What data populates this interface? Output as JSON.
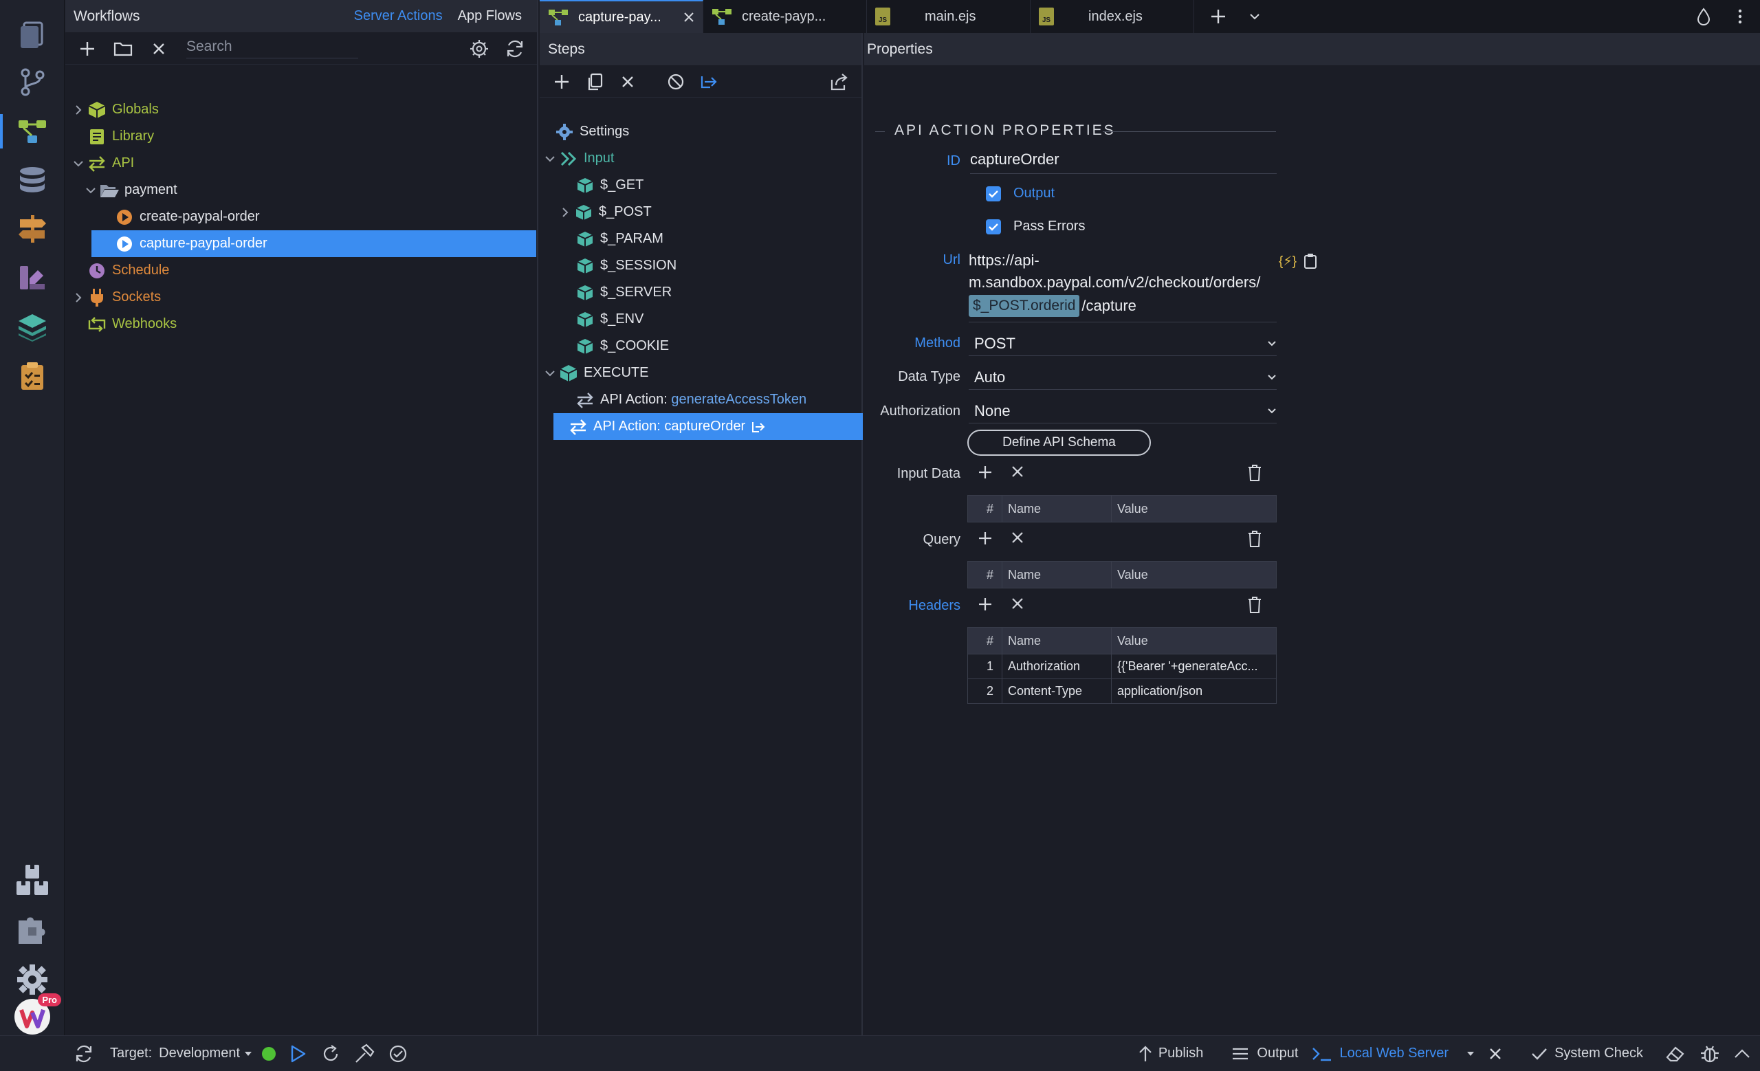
{
  "workflows_panel": {
    "title": "Workflows",
    "tab_server_actions": "Server Actions",
    "tab_app_flows": "App Flows",
    "search_placeholder": "Search",
    "tree": {
      "globals": "Globals",
      "library": "Library",
      "api": "API",
      "payment": "payment",
      "create_order": "create-paypal-order",
      "capture_order": "capture-paypal-order",
      "schedule": "Schedule",
      "sockets": "Sockets",
      "webhooks": "Webhooks"
    }
  },
  "tabs": [
    {
      "label": "capture-pay...",
      "icon": "workflow-icon"
    },
    {
      "label": "create-payp...",
      "icon": "workflow-icon"
    },
    {
      "label": "main.ejs",
      "icon": "js-file-icon"
    },
    {
      "label": "index.ejs",
      "icon": "js-file-icon"
    }
  ],
  "js_badge": "JS",
  "steps_panel": {
    "title": "Steps",
    "settings": "Settings",
    "input": "Input",
    "inputs": [
      "$_GET",
      "$_POST",
      "$_PARAM",
      "$_SESSION",
      "$_SERVER",
      "$_ENV",
      "$_COOKIE"
    ],
    "execute": "EXECUTE",
    "action1_prefix": "API Action: ",
    "action1_name": "generateAccessToken",
    "action2_label": "API Action: captureOrder"
  },
  "properties_panel": {
    "title": "Properties",
    "section_title": "API ACTION PROPERTIES",
    "id_label": "ID",
    "id_value": "captureOrder",
    "output_label": "Output",
    "pass_errors_label": "Pass Errors",
    "url_label": "Url",
    "url_line1": "https://api-",
    "url_line2": "m.sandbox.paypal.com/v2/checkout/orders/",
    "url_binding": "$_POST.orderid",
    "url_suffix": "/capture",
    "url_binding_icon": "{⚡}",
    "method_label": "Method",
    "method_value": "POST",
    "data_type_label": "Data Type",
    "data_type_value": "Auto",
    "authorization_label": "Authorization",
    "authorization_value": "None",
    "define_schema_button": "Define API Schema",
    "input_data_label": "Input Data",
    "query_label": "Query",
    "headers_label": "Headers",
    "table_cols": {
      "num": "#",
      "name": "Name",
      "value": "Value"
    },
    "headers": [
      {
        "num": "1",
        "name": "Authorization",
        "value": "{{'Bearer '+generateAcc..."
      },
      {
        "num": "2",
        "name": "Content-Type",
        "value": "application/json"
      }
    ]
  },
  "status_bar": {
    "target_label": "Target:",
    "target_value": "Development",
    "publish": "Publish",
    "output": "Output",
    "local_web_server": "Local Web Server",
    "system_check": "System Check",
    "pro_badge": "Pro"
  },
  "colors": {
    "accent": "#3b8df1",
    "selected": "#3b8df1",
    "server_green": "#4fc235",
    "globals_green": "#a9c443",
    "orange": "#e08a3c"
  }
}
